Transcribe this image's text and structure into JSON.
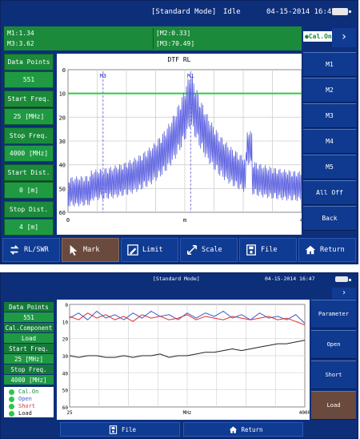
{
  "colors": {
    "accent": "#1b8a3a",
    "frame": "#0d2f7a",
    "active": "#6b4a3e",
    "trace1": "#5a5fe0",
    "limit": "#2ecc40",
    "open_trace": "#3b5bd6",
    "short_trace": "#e03030",
    "load_trace": "#222222"
  },
  "screen1": {
    "header": {
      "mode": "[Standard Mode]",
      "status": "Idle",
      "datetime": "04-15-2014 16:47",
      "battery_icon": "battery-icon"
    },
    "markers": {
      "m1": "M1:1.34",
      "m3": "M3:3.62",
      "m2": "[M2:0.33]",
      "m3_val": "[M3:70.49]"
    },
    "cal_status": "●Cal.On",
    "next_arrow": "›",
    "left_panel": [
      {
        "label": "Data Points",
        "value": "551"
      },
      {
        "label": "Start Freq.",
        "value": "25 [MHz]"
      },
      {
        "label": "Stop Freq.",
        "value": "4000 [MHz]"
      },
      {
        "label": "Start Dist.",
        "value": "0 [m]"
      },
      {
        "label": "Stop Dist.",
        "value": "4 [m]"
      }
    ],
    "right_menu": [
      "M1",
      "M2",
      "M3",
      "M4",
      "M5",
      "All Off",
      "Back"
    ],
    "bottom_bar": [
      {
        "label": "RL/SWR",
        "icon": "swap-arrows-icon",
        "active": false
      },
      {
        "label": "Mark",
        "icon": "cursor-icon",
        "active": true
      },
      {
        "label": "Limit",
        "icon": "pencil-icon",
        "active": false
      },
      {
        "label": "Scale",
        "icon": "resize-icon",
        "active": false
      },
      {
        "label": "File",
        "icon": "disk-icon",
        "active": false
      },
      {
        "label": "Return",
        "icon": "home-icon",
        "active": false
      }
    ]
  },
  "chart1": {
    "type": "line",
    "title": "DTF RL",
    "xlim": [
      0,
      4
    ],
    "ylim": [
      0,
      60
    ],
    "y_inverted": true,
    "x_ticks": [
      "0",
      "",
      "m",
      "",
      "4"
    ],
    "y_ticks": [
      "0",
      "10",
      "20",
      "30",
      "40",
      "50",
      "60"
    ],
    "marker_labels": [
      "M3",
      "M1"
    ],
    "marker_x": [
      0.6,
      2.1
    ],
    "limit_line": 10,
    "grid": true
  },
  "screen2": {
    "header": {
      "mode": "[Standard Mode]",
      "datetime": "04-15-2014 16:47",
      "battery_icon": "battery-icon"
    },
    "next_arrow": "›",
    "left_panel": [
      {
        "label": "Data Points",
        "value": "551"
      },
      {
        "label": "Cal.Component",
        "value": "Load"
      },
      {
        "label": "Start Freq.",
        "value": "25 [MHz]"
      },
      {
        "label": "Stop Freq.",
        "value": "4000 [MHz]"
      }
    ],
    "legend": [
      {
        "label": "Cal.On",
        "color": "#1b8a3a"
      },
      {
        "label": "Open",
        "color": "#3b5bd6"
      },
      {
        "label": "Short",
        "color": "#e03030"
      },
      {
        "label": "Load",
        "color": "#111111"
      }
    ],
    "right_menu": [
      {
        "label": "Parameter",
        "active": false
      },
      {
        "label": "Open",
        "active": false
      },
      {
        "label": "Short",
        "active": false
      },
      {
        "label": "Load",
        "active": true
      }
    ],
    "bottom_bar": [
      {
        "label": "File",
        "icon": "disk-icon"
      },
      {
        "label": "Return",
        "icon": "home-icon"
      }
    ]
  },
  "chart2": {
    "type": "line",
    "xlim": [
      25,
      4000
    ],
    "ylim": [
      0,
      60
    ],
    "y_inverted": true,
    "x_ticks": [
      "25",
      "",
      "",
      "",
      "MHz",
      "",
      "",
      "",
      "4000"
    ],
    "y_ticks": [
      "0",
      "10",
      "20",
      "30",
      "40",
      "50",
      "60"
    ],
    "grid": true,
    "series": [
      {
        "name": "Open",
        "values": [
          8,
          5,
          9,
          4,
          8,
          6,
          9,
          5,
          8,
          4,
          7,
          6,
          9,
          5,
          8,
          5,
          7,
          4,
          8,
          6,
          9,
          5,
          8,
          7,
          9,
          6,
          11
        ]
      },
      {
        "name": "Short",
        "values": [
          7,
          9,
          5,
          8,
          6,
          9,
          7,
          10,
          6,
          8,
          7,
          9,
          8,
          6,
          9,
          7,
          8,
          9,
          7,
          8,
          9,
          8,
          7,
          9,
          8,
          10,
          12
        ]
      },
      {
        "name": "Load",
        "values": [
          30,
          31,
          30,
          30,
          31,
          31,
          30,
          31,
          30,
          30,
          29,
          31,
          30,
          30,
          29,
          28,
          28,
          27,
          26,
          27,
          26,
          25,
          24,
          23,
          23,
          22,
          21
        ]
      }
    ]
  }
}
